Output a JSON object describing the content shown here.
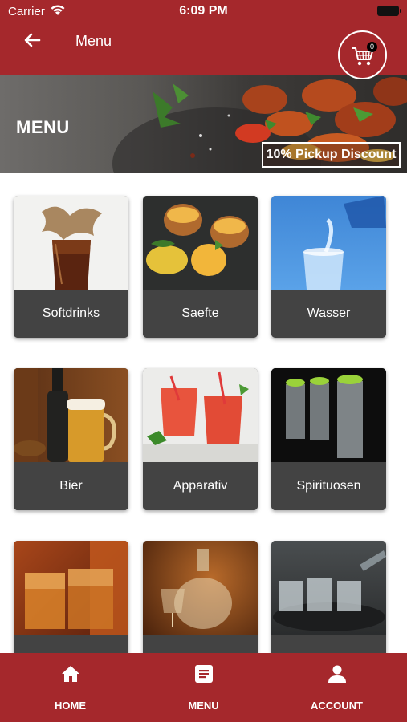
{
  "status_bar": {
    "carrier": "Carrier",
    "time": "6:09 PM"
  },
  "header": {
    "title": "Menu",
    "back_icon": "back-arrow-icon",
    "cart_count": "0",
    "color": "#a5282c"
  },
  "banner": {
    "title": "MENU",
    "discount": "10% Pickup Discount"
  },
  "categories": [
    {
      "label": "Softdrinks",
      "icon": "softdrink-glass-image"
    },
    {
      "label": "Saefte",
      "icon": "juice-bowls-image"
    },
    {
      "label": "Wasser",
      "icon": "water-glass-image"
    },
    {
      "label": "Bier",
      "icon": "beer-mug-image"
    },
    {
      "label": "Apparativ",
      "icon": "cocktail-glasses-image"
    },
    {
      "label": "Spirituosen",
      "icon": "shot-glasses-image"
    },
    {
      "label": "",
      "icon": "whiskey-glasses-image"
    },
    {
      "label": "",
      "icon": "carafe-image"
    },
    {
      "label": "",
      "icon": "vodka-shots-image"
    }
  ],
  "tabs": [
    {
      "label": "HOME",
      "icon": "home-icon"
    },
    {
      "label": "MENU",
      "icon": "menu-list-icon"
    },
    {
      "label": "ACCOUNT",
      "icon": "account-icon"
    }
  ]
}
